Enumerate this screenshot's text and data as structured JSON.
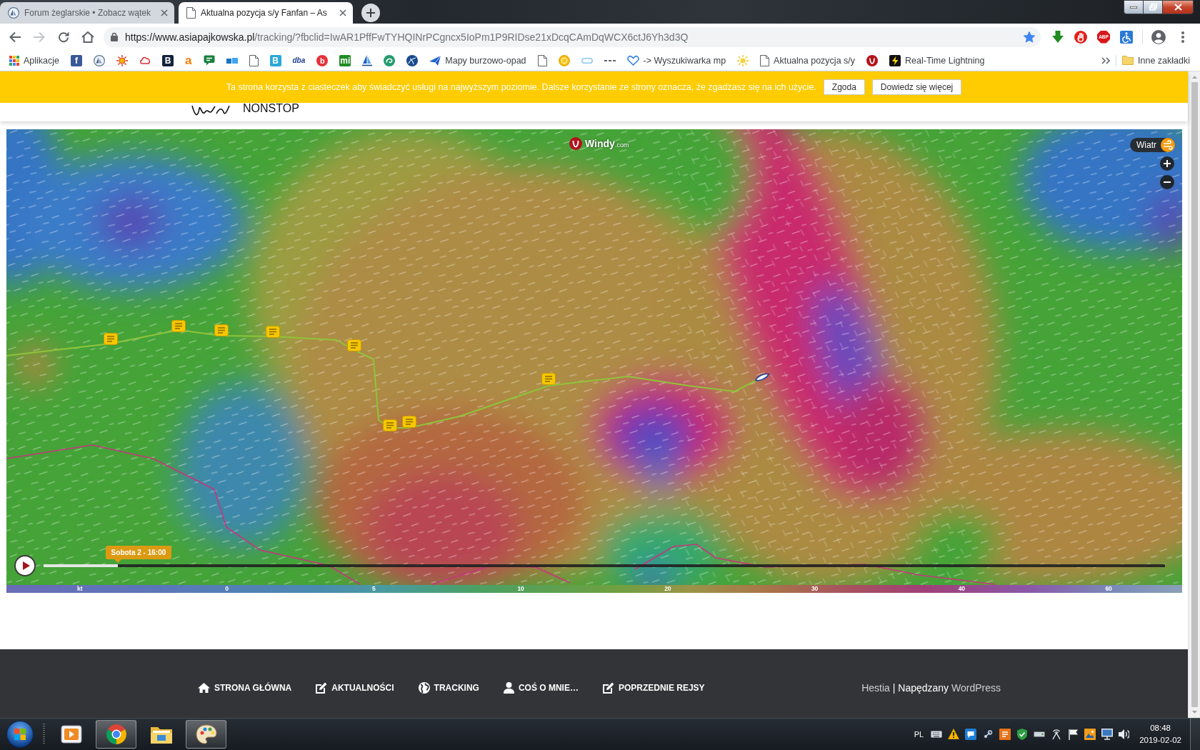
{
  "browser": {
    "tabs": [
      {
        "title": "Forum żeglarskie • Zobacz wątek",
        "selected": false,
        "kind": "emblem"
      },
      {
        "title": "Aktualna pozycja s/y Fanfan – As",
        "selected": true,
        "kind": "page"
      }
    ],
    "navigation": {
      "back_enabled": true,
      "forward_enabled": false
    },
    "address": {
      "origin": "https://www.asiapajkowska.pl",
      "path": "/tracking/?fbclid=IwAR1PffFwTYHQINrPCgncx5IoPm1P9RIDse21xDcqCAmDqWCX6ctJ6Yh3d3Q",
      "bookmarked": true
    },
    "extensions": [
      {
        "kind": "download"
      },
      {
        "kind": "hand"
      },
      {
        "kind": "octagon",
        "glyph": "ABP"
      },
      {
        "kind": "wheelchair"
      }
    ],
    "bookmarks": [
      {
        "kind": "grid",
        "label": "Aplikacje"
      },
      {
        "kind": "tile",
        "glyph": "f",
        "color": "#3b5998"
      },
      {
        "kind": "emblem"
      },
      {
        "kind": "sun"
      },
      {
        "kind": "cloud"
      },
      {
        "kind": "tile",
        "glyph": "B",
        "color": "#14233c"
      },
      {
        "kind": "letter",
        "glyph": "a",
        "color": "#f57c00"
      },
      {
        "kind": "chat"
      },
      {
        "kind": "blocks"
      },
      {
        "kind": "page"
      },
      {
        "kind": "tile",
        "glyph": "B",
        "color": "#2aa8d8"
      },
      {
        "kind": "letter",
        "glyph": "dba",
        "color": "#1b3f8f"
      },
      {
        "kind": "disc",
        "glyph": "b",
        "color": "#e53238"
      },
      {
        "kind": "tile",
        "glyph": "mi",
        "color": "#1e8c23"
      },
      {
        "kind": "sail"
      },
      {
        "kind": "swirl"
      },
      {
        "kind": "globe"
      },
      {
        "kind": "plane",
        "label": "Mapy burzowo-opad"
      },
      {
        "kind": "page"
      },
      {
        "kind": "coin"
      },
      {
        "kind": "pill"
      },
      {
        "kind": "dashes"
      },
      {
        "kind": "heart",
        "label": "-> Wyszukiwarka mp"
      },
      {
        "kind": "sunny"
      },
      {
        "kind": "page",
        "label": "Aktualna pozycja s/y"
      },
      {
        "kind": "mark"
      },
      {
        "kind": "bolt",
        "label": "Real-Time Lightning"
      }
    ],
    "other_bookmarks": "Inne zakładki"
  },
  "cookie_bar": {
    "text": "Ta strona korzysta z ciasteczek aby świadczyć usługi na najwyższym poziomie. Dalsze korzystanie ze strony oznacza, że zgadzasz się na ich użycie.",
    "buttons": [
      "Zgoda",
      "Dowiedz się więcej"
    ]
  },
  "site_header": {
    "logo_text": "NONSTOP"
  },
  "map": {
    "logo": {
      "name": "Windy",
      "suffix": ".com"
    },
    "layer": "Wiatr",
    "timeline": {
      "time": "Sobota 2 - 16:00",
      "level": 0.066,
      "playing": false
    },
    "legend": {
      "unit": "kt",
      "values": [
        "0",
        "5",
        "10",
        "20",
        "30",
        "40",
        "60"
      ]
    }
  },
  "footer": {
    "menu": [
      {
        "label": "STRONA GŁÓWNA",
        "kind": "home"
      },
      {
        "label": "AKTUALNOŚCI",
        "kind": "edit"
      },
      {
        "label": "TRACKING",
        "kind": "globe"
      },
      {
        "label": "COŚ O MNIE…",
        "kind": "user"
      },
      {
        "label": "POPRZEDNIE REJSY",
        "kind": "edit"
      }
    ],
    "credit": {
      "theme": "Hestia",
      "separator": "|",
      "text": "Napędzany",
      "platform": "WordPress"
    }
  },
  "taskbar": {
    "apps": [
      {
        "kind": "media",
        "running": false
      },
      {
        "kind": "browser",
        "running": true
      },
      {
        "kind": "folder",
        "running": false
      },
      {
        "kind": "paint",
        "running": true
      }
    ],
    "language": "PL",
    "time": "08:48",
    "date": "2019-02-02"
  }
}
